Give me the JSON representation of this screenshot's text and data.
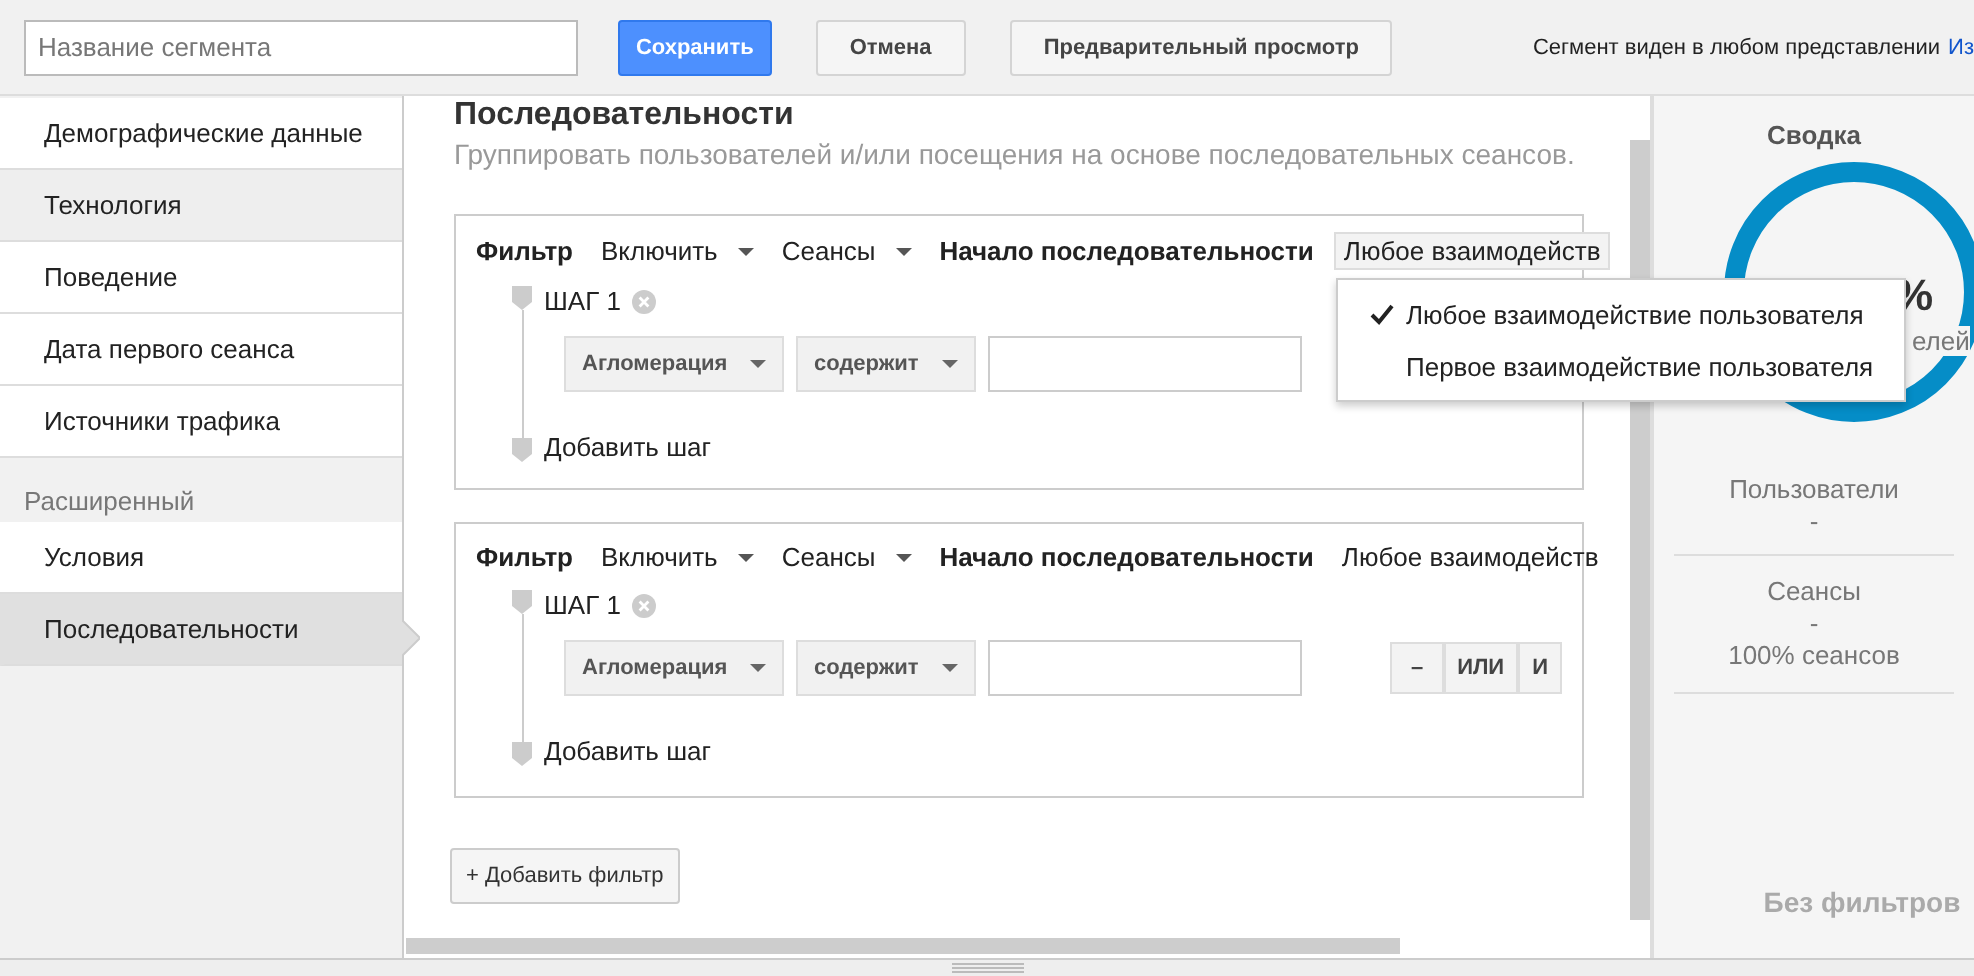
{
  "toolbar": {
    "name_field": {
      "placeholder": "Название сегмента"
    },
    "buttons": [
      {
        "label": "Сохранить",
        "kind": "primary"
      },
      {
        "label": "Отмена",
        "kind": "plain"
      },
      {
        "label": "Предварительный просмотр",
        "kind": "plain"
      }
    ],
    "visibility_text": "Сегмент виден в любом представлении",
    "visibility_link": "Из"
  },
  "sidebar": {
    "groups": [
      {
        "items": [
          {
            "label": "Демографические данные",
            "selected": false,
            "hovered": false
          },
          {
            "label": "Технология",
            "selected": false,
            "hovered": true
          },
          {
            "label": "Поведение",
            "selected": false,
            "hovered": false
          },
          {
            "label": "Дата первого сеанса",
            "selected": false,
            "hovered": false
          },
          {
            "label": "Источники трафика",
            "selected": false,
            "hovered": false
          }
        ]
      },
      {
        "header": "Расширенный",
        "items": [
          {
            "label": "Условия",
            "selected": false,
            "hovered": false
          },
          {
            "label": "Последовательности",
            "selected": true,
            "hovered": false
          }
        ]
      }
    ]
  },
  "main": {
    "title": "Последовательности",
    "subtitle": "Группировать пользователей и/или посещения на основе последовательных сеансов.",
    "filters": [
      {
        "label": "Фильтр",
        "include": "Включить",
        "scope": "Сеансы",
        "start_label": "Начало последовательности",
        "start_value": "Любое взаимодейств",
        "start_open": true,
        "step_label": "ШАГ 1",
        "dimension": "Агломерация",
        "operator": "содержит",
        "add_step": "Добавить шаг"
      },
      {
        "label": "Фильтр",
        "include": "Включить",
        "scope": "Сеансы",
        "start_label": "Начало последовательности",
        "start_value": "Любое взаимодейств",
        "start_open": false,
        "step_label": "ШАГ 1",
        "dimension": "Агломерация",
        "operator": "содержит",
        "logic_buttons": [
          "–",
          "ИЛИ",
          "И"
        ],
        "add_step": "Добавить шаг"
      }
    ],
    "add_filter": "+ Добавить фильтр"
  },
  "dropdown_menu": {
    "items": [
      {
        "label": "Любое взаимодействие пользователя",
        "checked": true
      },
      {
        "label": "Первое взаимодействие пользователя",
        "checked": false
      }
    ]
  },
  "summary": {
    "title": "Сводка",
    "donut_value": "%",
    "donut_caption": "елей",
    "users_label": "Пользователи",
    "users_value": "-",
    "sessions_label": "Сеансы",
    "sessions_value": "-",
    "sessions_share": "100% сеансов",
    "footer": "Без фильтров"
  }
}
